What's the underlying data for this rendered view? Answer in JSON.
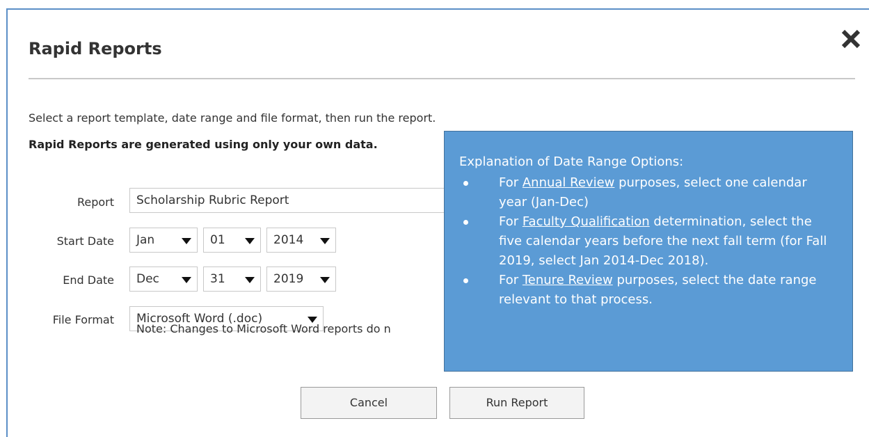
{
  "dialog": {
    "title": "Rapid Reports",
    "close_icon": "close-icon",
    "intro_text": "Select a report template, date range and file format, then run the report.",
    "intro_bold": "Rapid Reports are generated using only your own data."
  },
  "form": {
    "report": {
      "label": "Report",
      "value": "Scholarship Rubric Report"
    },
    "start_date": {
      "label": "Start Date",
      "month": "Jan",
      "day": "01",
      "year": "2014"
    },
    "end_date": {
      "label": "End Date",
      "month": "Dec",
      "day": "31",
      "year": "2019"
    },
    "file_format": {
      "label": "File Format",
      "value": "Microsoft Word (.doc)"
    },
    "note": "Note: Changes to Microsoft Word reports do n"
  },
  "buttons": {
    "cancel": "Cancel",
    "run": "Run Report"
  },
  "tooltip": {
    "heading": "Explanation of Date Range Options:",
    "items": [
      {
        "pre": "For ",
        "link": "Annual Review",
        "post": " purposes, select one calendar year (Jan-Dec)"
      },
      {
        "pre": "For ",
        "link": "Faculty Qualification",
        "post": " determination, select the five calendar years before the next fall term (for Fall 2019, select Jan 2014-Dec 2018)."
      },
      {
        "pre": "For ",
        "link": "Tenure Review",
        "post": " purposes, select the date range relevant to that process."
      }
    ]
  },
  "colors": {
    "tooltip_bg": "#5b9bd5",
    "modal_border": "#5b8fc7"
  }
}
